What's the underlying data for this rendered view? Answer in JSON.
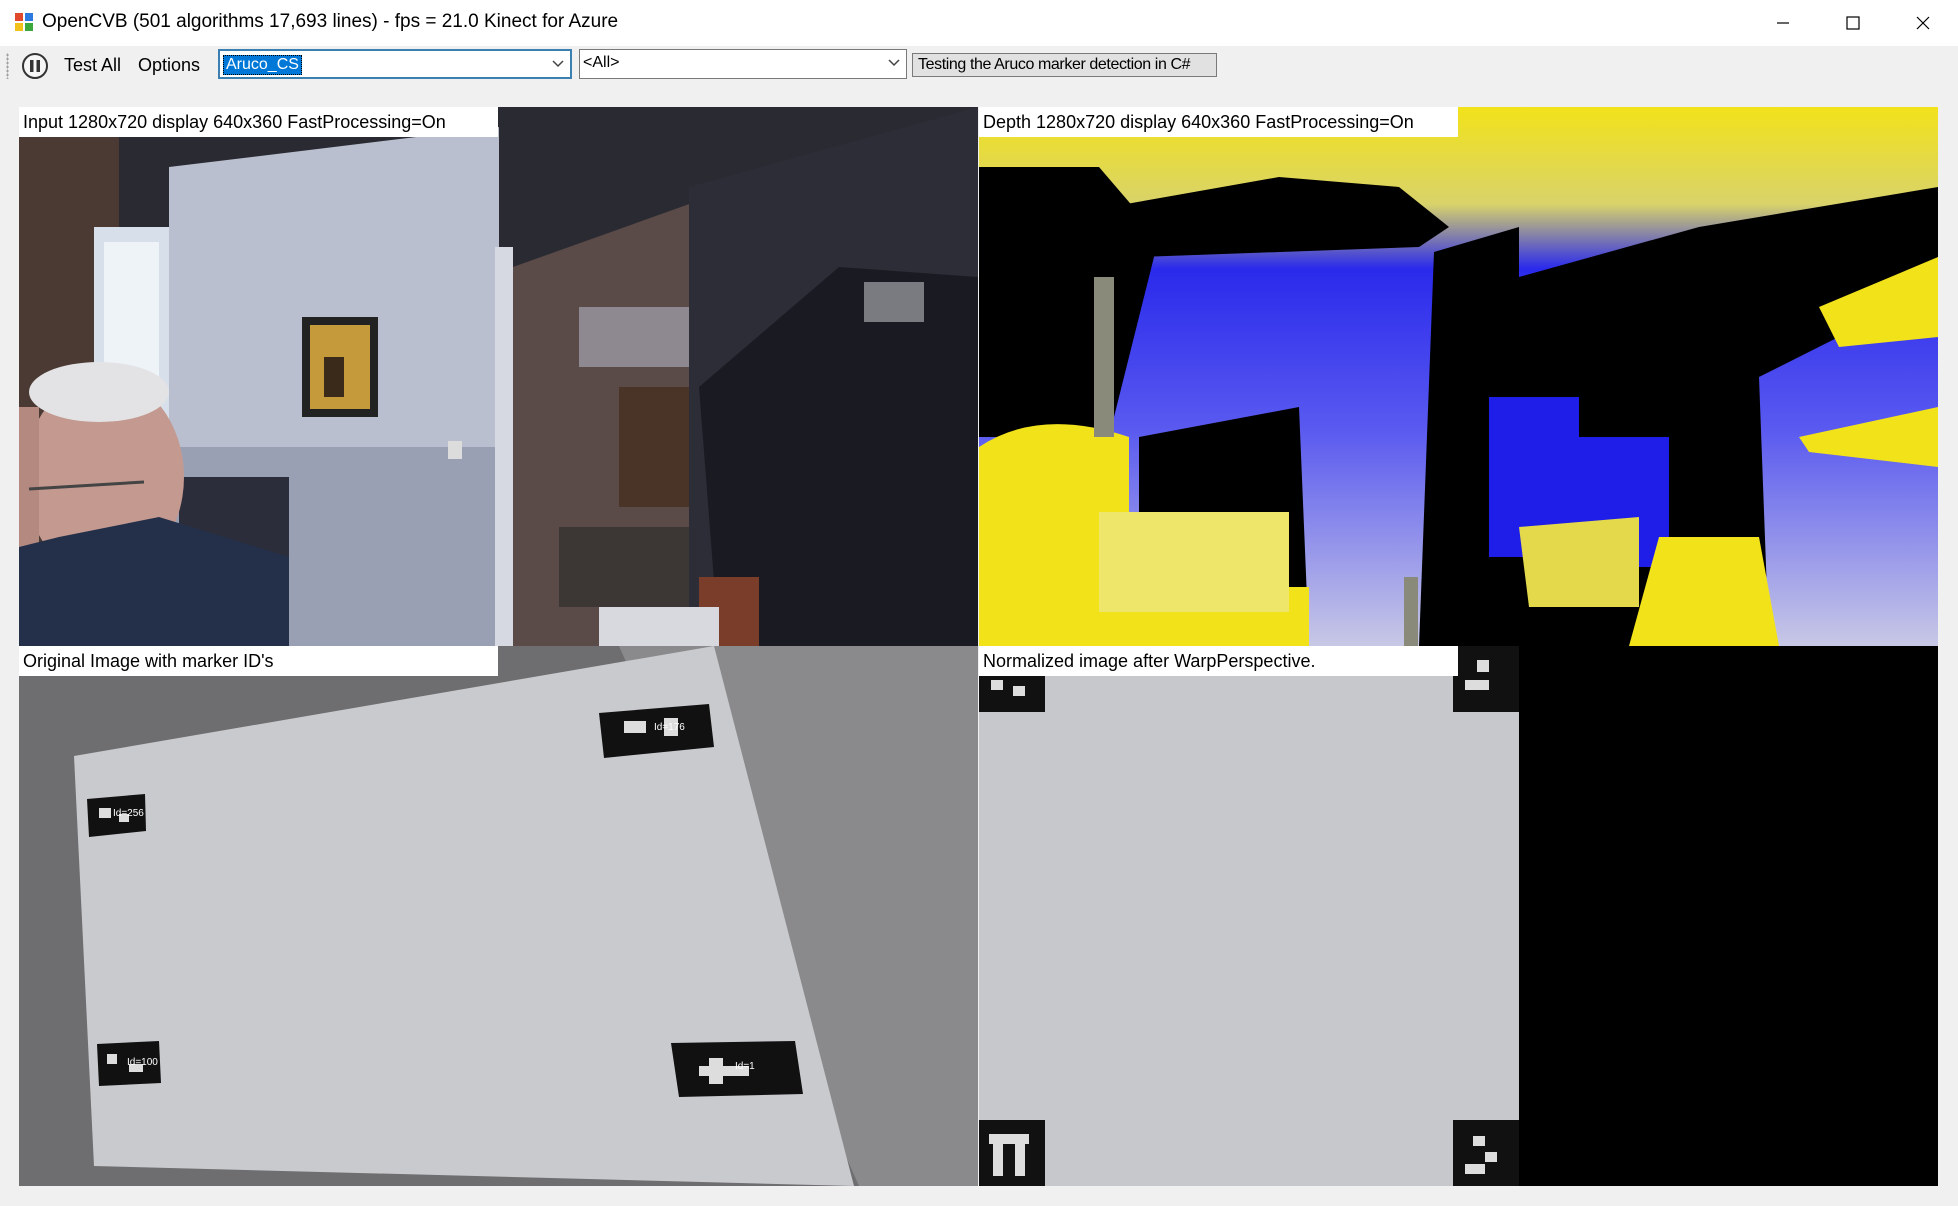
{
  "window": {
    "title": "OpenCVB (501 algorithms 17,693 lines) - fps = 21.0 Kinect for Azure"
  },
  "toolbar": {
    "test_all_label": "Test All",
    "options_label": "Options",
    "algorithm_combo_value": "Aruco_CS",
    "group_combo_value": "<All>",
    "description": "Testing the Aruco marker detection in C#"
  },
  "panels": {
    "input_caption": "Input  1280x720  display  640x360  FastProcessing=On",
    "depth_caption": "Depth  1280x720  display  640x360  FastProcessing=On",
    "original_caption": "Original Image with marker ID's",
    "normalized_caption": "Normalized image after WarpPerspective."
  },
  "markers": {
    "ids": [
      "Id=256",
      "Id=176",
      "Id=100",
      "Id=1"
    ]
  },
  "colors": {
    "depth_yellow": "#f2e21a",
    "depth_blue": "#1f1ee8",
    "selection_blue": "#0078d7"
  }
}
